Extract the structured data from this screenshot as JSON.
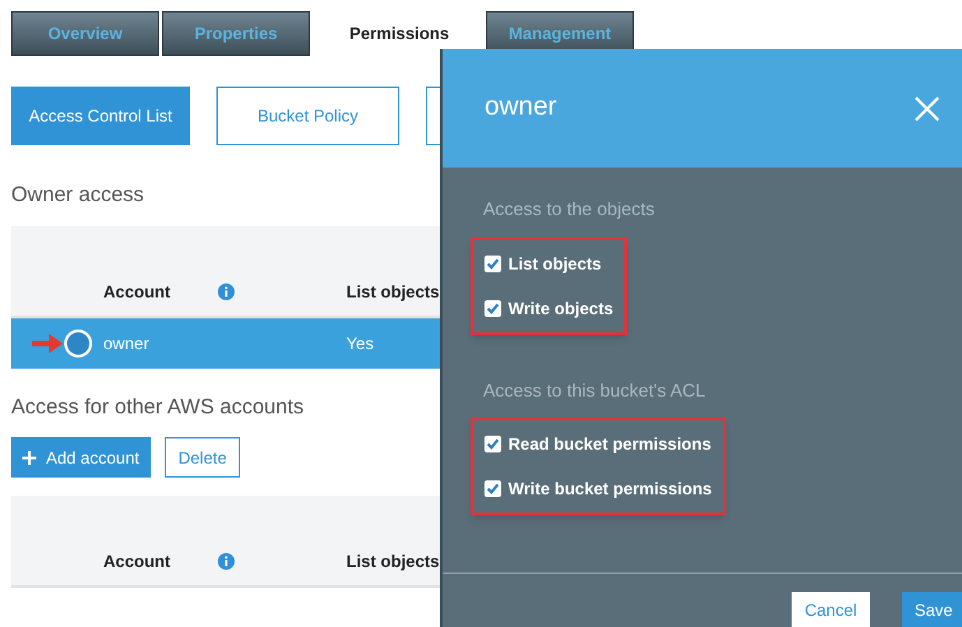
{
  "tabs": [
    {
      "label": "Overview",
      "selected": false
    },
    {
      "label": "Properties",
      "selected": false
    },
    {
      "label": "Permissions",
      "selected": true
    },
    {
      "label": "Management",
      "selected": false
    }
  ],
  "sub_tabs": [
    {
      "label": "Access Control List",
      "selected": true
    },
    {
      "label": "Bucket Policy",
      "selected": false
    }
  ],
  "owner_access": {
    "title": "Owner access",
    "columns": [
      {
        "label": "Account",
        "info": true
      },
      {
        "label": "List objects",
        "info": false
      }
    ],
    "rows": [
      {
        "account": "owner",
        "list_objects": "Yes",
        "selected": true,
        "pointer": true
      }
    ]
  },
  "other_accounts": {
    "title": "Access for other AWS accounts",
    "buttons": [
      {
        "label": "Add account",
        "kind": "primary"
      },
      {
        "label": "Delete",
        "kind": "secondary"
      }
    ],
    "columns": [
      {
        "label": "Account",
        "info": true
      },
      {
        "label": "List objects",
        "info": false
      }
    ]
  },
  "panel": {
    "title": "owner",
    "sections": [
      {
        "title": "Access to the objects",
        "highlighted": true,
        "options": [
          {
            "label": "List objects",
            "checked": true
          },
          {
            "label": "Write objects",
            "checked": true
          }
        ]
      },
      {
        "title": "Access to this bucket's ACL",
        "highlighted": true,
        "options": [
          {
            "label": "Read bucket permissions",
            "checked": true
          },
          {
            "label": "Write bucket permissions",
            "checked": true
          }
        ]
      }
    ],
    "buttons": [
      {
        "label": "Cancel",
        "kind": "secondary"
      },
      {
        "label": "Save",
        "kind": "primary"
      }
    ]
  }
}
